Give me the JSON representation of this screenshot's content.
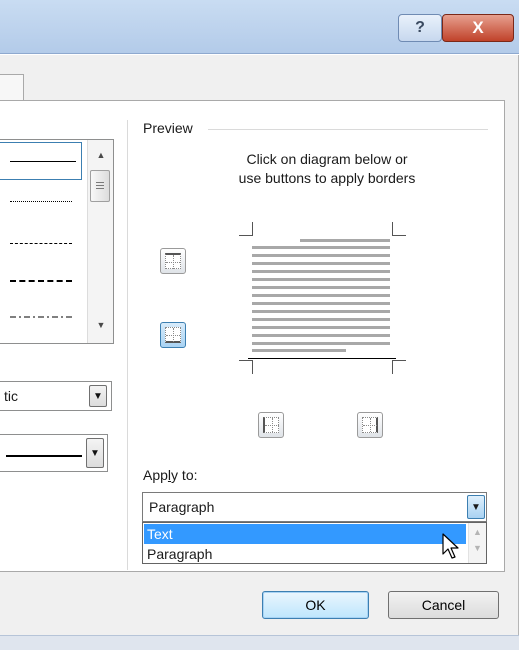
{
  "titlebar": {
    "help_glyph": "?",
    "close_glyph": "X",
    "help_icon": "help-icon",
    "close_icon": "close-icon"
  },
  "style_list": {
    "scroll_up_glyph": "▲",
    "scroll_down_glyph": "▼"
  },
  "left_combos": {
    "color_value": "tic",
    "dropdown_glyph": "▼"
  },
  "preview": {
    "title": "Preview",
    "instructions_line1": "Click on diagram below or",
    "instructions_line2": "use buttons to apply borders"
  },
  "apply_to": {
    "label": "Apply to:",
    "access_key": "l",
    "selected": "Paragraph",
    "dropdown_glyph": "▼",
    "options": [
      "Text",
      "Paragraph"
    ],
    "highlighted_option": "Text"
  },
  "buttons": {
    "ok": "OK",
    "cancel": "Cancel"
  },
  "colors": {
    "accent": "#3c7fb1",
    "highlight": "#3399ff",
    "close_red": "#c0422a"
  }
}
